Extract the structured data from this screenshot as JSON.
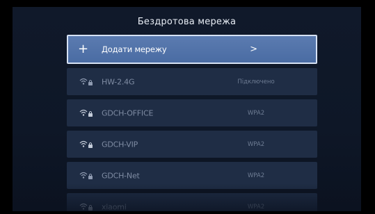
{
  "header": {
    "title": "Бездротова мережа"
  },
  "add_network": {
    "label": "Додати мережу"
  },
  "networks": [
    {
      "ssid": "HW-2.4G",
      "status": "Підключено"
    },
    {
      "ssid": "GDCH-OFFICE",
      "status": "WPA2"
    },
    {
      "ssid": "GDCH-VIP",
      "status": "WPA2"
    },
    {
      "ssid": "GDCH-Net",
      "status": "WPA2"
    },
    {
      "ssid": "xiaomi",
      "status": "WPA2"
    }
  ],
  "icons": {
    "add": "plus-icon",
    "chevron": "chevron-right-icon",
    "network": "wifi-lock-icon"
  },
  "colors": {
    "background": "#0e1727",
    "row": "#1f2d45",
    "selected_row": "#4a6ca3",
    "selected_border": "#d7e2f4"
  }
}
